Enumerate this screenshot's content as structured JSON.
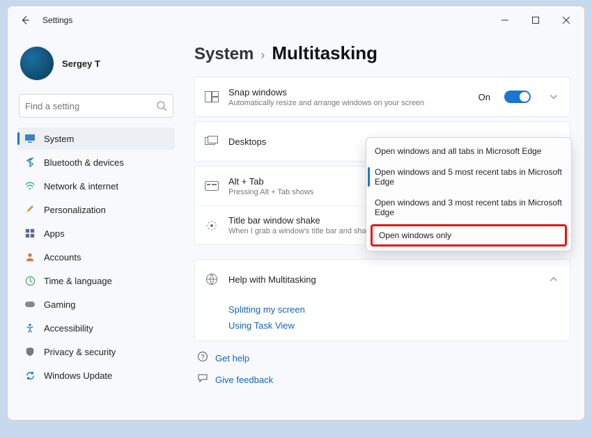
{
  "window": {
    "title": "Settings",
    "user_name": "Sergey T"
  },
  "search": {
    "placeholder": "Find a setting"
  },
  "sidebar": {
    "items": [
      {
        "label": "System",
        "icon": "display-icon",
        "selected": true
      },
      {
        "label": "Bluetooth & devices",
        "icon": "bluetooth-icon"
      },
      {
        "label": "Network & internet",
        "icon": "wifi-icon"
      },
      {
        "label": "Personalization",
        "icon": "brush-icon"
      },
      {
        "label": "Apps",
        "icon": "apps-icon"
      },
      {
        "label": "Accounts",
        "icon": "person-icon"
      },
      {
        "label": "Time & language",
        "icon": "globe-clock-icon"
      },
      {
        "label": "Gaming",
        "icon": "gamepad-icon"
      },
      {
        "label": "Accessibility",
        "icon": "accessibility-icon"
      },
      {
        "label": "Privacy & security",
        "icon": "shield-icon"
      },
      {
        "label": "Windows Update",
        "icon": "update-icon"
      }
    ]
  },
  "breadcrumb": {
    "parent": "System",
    "current": "Multitasking"
  },
  "settings": {
    "snap": {
      "title": "Snap windows",
      "sub": "Automatically resize and arrange windows on your screen",
      "state": "On"
    },
    "desktops": {
      "title": "Desktops"
    },
    "alttab": {
      "title": "Alt + Tab",
      "sub": "Pressing Alt + Tab shows",
      "options": [
        "Open windows and all tabs in Microsoft Edge",
        "Open windows and 5 most recent tabs in Microsoft Edge",
        "Open windows and 3 most recent tabs in Microsoft Edge",
        "Open windows only"
      ],
      "selected_index": 1,
      "highlighted_index": 3
    },
    "shake": {
      "title": "Title bar window shake",
      "sub": "When I grab a window's title bar and shake it, min"
    }
  },
  "help": {
    "title": "Help with Multitasking",
    "links": [
      "Splitting my screen",
      "Using Task View"
    ]
  },
  "footer": {
    "get_help": "Get help",
    "give_feedback": "Give feedback"
  },
  "colors": {
    "accent": "#1976d2",
    "highlight": "#e11"
  }
}
